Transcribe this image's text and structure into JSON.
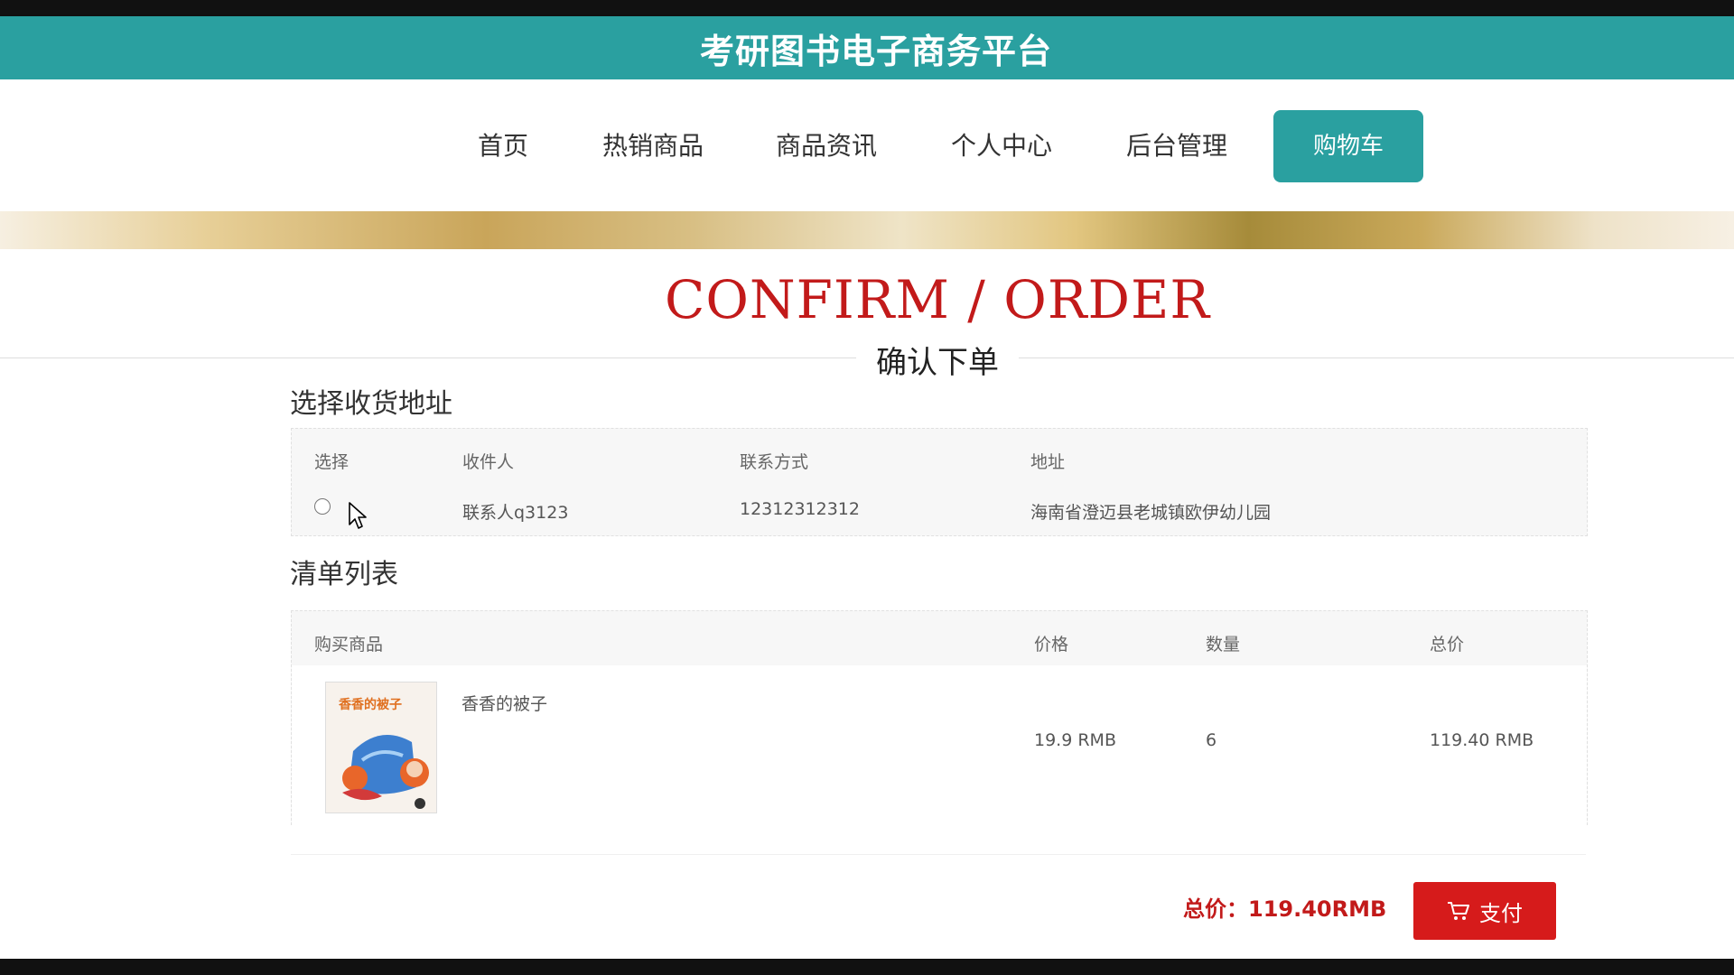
{
  "header": {
    "title": "考研图书电子商务平台"
  },
  "nav": {
    "items": [
      {
        "label": "首页"
      },
      {
        "label": "热销商品"
      },
      {
        "label": "商品资讯"
      },
      {
        "label": "个人中心"
      },
      {
        "label": "后台管理"
      },
      {
        "label": "购物车",
        "active": true
      }
    ]
  },
  "page": {
    "title": "CONFIRM / ORDER",
    "subtitle": "确认下单"
  },
  "address_section": {
    "title": "选择收货地址",
    "headers": [
      "选择",
      "收件人",
      "联系方式",
      "地址"
    ],
    "rows": [
      {
        "selected": false,
        "recipient": "联系人q3123",
        "phone": "12312312312",
        "address": "海南省澄迈县老城镇欧伊幼儿园"
      }
    ]
  },
  "items_section": {
    "title": "清单列表",
    "headers": [
      "购买商品",
      "价格",
      "数量",
      "总价"
    ],
    "rows": [
      {
        "name": "香香的被子",
        "cover_text": "香香的被子",
        "price": "19.9 RMB",
        "quantity": "6",
        "total": "119.40 RMB"
      }
    ]
  },
  "summary": {
    "total_label": "总价：",
    "total_value": "119.40RMB",
    "pay_label": "支付"
  },
  "colors": {
    "brand": "#2aa0a0",
    "accent_red": "#c21a1a",
    "button_red": "#d61b1b"
  }
}
